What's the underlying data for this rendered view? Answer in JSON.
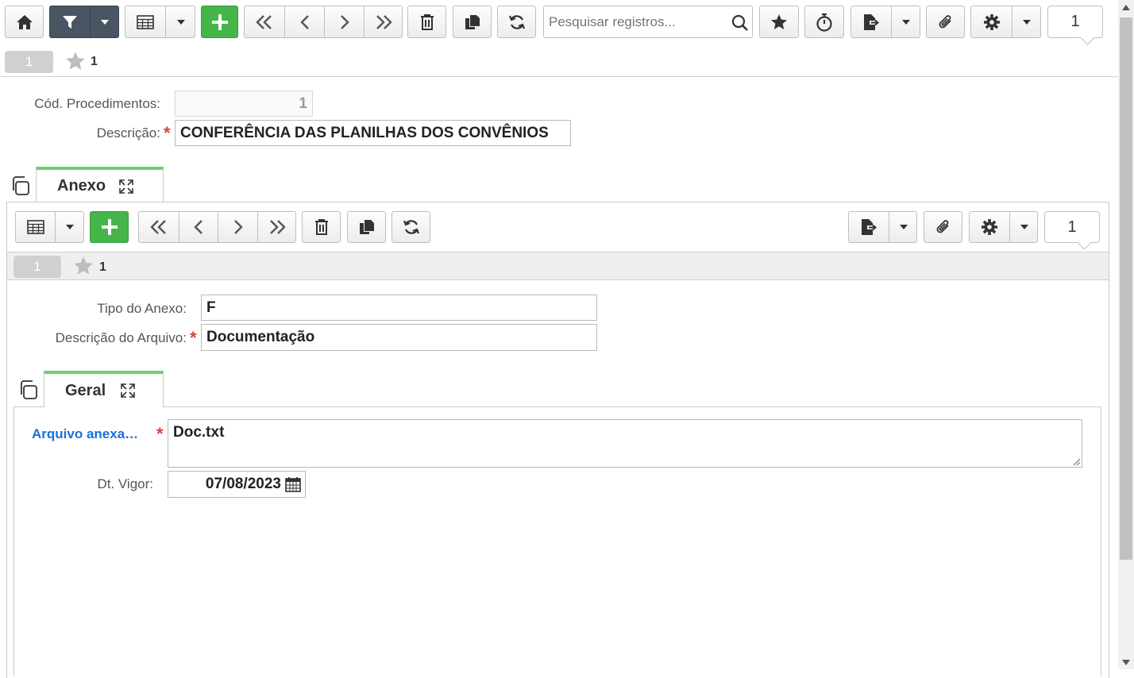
{
  "toolbar": {
    "search_placeholder": "Pesquisar registros...",
    "record_number": "1"
  },
  "record_bar": {
    "pill": "1",
    "fav_count": "1"
  },
  "form": {
    "cod_label": "Cód. Procedimentos:",
    "cod_value": "1",
    "desc_label": "Descrição:",
    "desc_value": "CONFERÊNCIA DAS PLANILHAS DOS CONVÊNIOS",
    "required_mark": "*"
  },
  "tab_anexo": {
    "label": "Anexo"
  },
  "sub_toolbar": {
    "record_number": "1"
  },
  "sub_record_bar": {
    "pill": "1",
    "fav_count": "1"
  },
  "sub_form": {
    "tipo_label": "Tipo do Anexo:",
    "tipo_value": "F",
    "descarq_label": "Descrição do Arquivo:",
    "descarq_value": "Documentação"
  },
  "tab_geral": {
    "label": "Geral"
  },
  "geral_form": {
    "arquivo_label": "Arquivo anexa…",
    "arquivo_value": "Doc.txt",
    "dtvigor_label": "Dt. Vigor:",
    "dtvigor_value": "07/08/2023"
  },
  "colors": {
    "accent_green": "#46b549",
    "required": "#d9423a",
    "link_blue": "#1a6fd6"
  }
}
